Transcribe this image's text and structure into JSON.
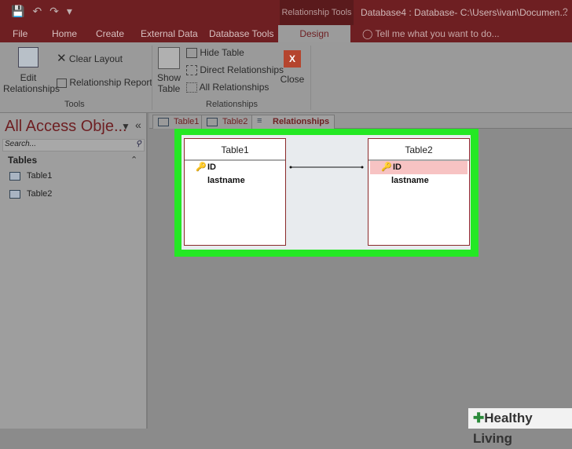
{
  "titlebar": {
    "context_tools": "Relationship Tools",
    "window_title": "Database4 : Database- C:\\Users\\ivan\\Documen...",
    "help": "?"
  },
  "tabs": [
    "File",
    "Home",
    "Create",
    "External Data",
    "Database Tools",
    "Design"
  ],
  "tell_me": "Tell me what you want to do...",
  "ribbon": {
    "edit_relationships": "Edit Relationships",
    "clear_layout": "Clear Layout",
    "relationship_report": "Relationship Report",
    "tools_group": "Tools",
    "show_table": "Show Table",
    "hide_table": "Hide Table",
    "direct_relationships": "Direct Relationships",
    "all_relationships": "All Relationships",
    "close": "Close",
    "relationships_group": "Relationships"
  },
  "nav": {
    "title": "All Access Obje...",
    "search_placeholder": "Search...",
    "section": "Tables",
    "items": [
      "Table1",
      "Table2"
    ]
  },
  "doc_tabs": [
    "Table1",
    "Table2",
    "Relationships"
  ],
  "tables": [
    {
      "name": "Table1",
      "fields": [
        "ID",
        "lastname"
      ]
    },
    {
      "name": "Table2",
      "fields": [
        "ID",
        "lastname"
      ]
    }
  ],
  "watermark": "Healthy Living"
}
